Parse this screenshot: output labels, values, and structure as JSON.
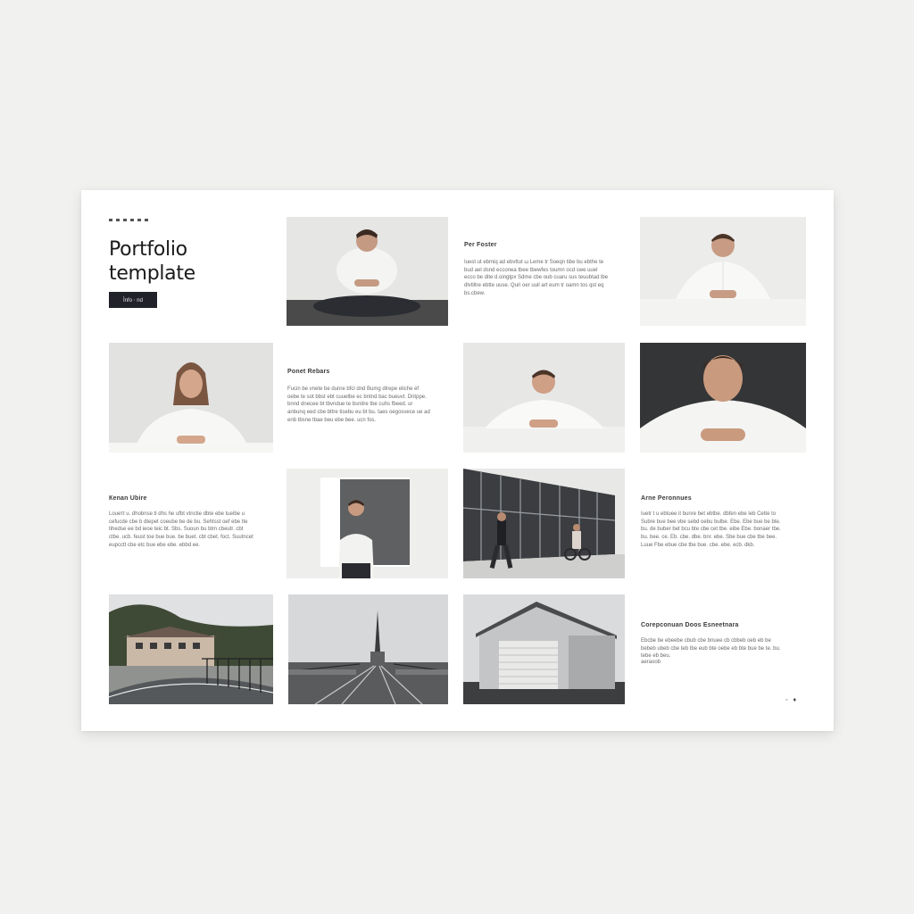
{
  "header": {
    "title_line1": "Portfolio",
    "title_line2": "template",
    "button_label": "Ìnfo ⋅ nd"
  },
  "text_blocks": [
    {
      "title": "Pеr Fоstеr",
      "body": "Ιuнst ut ebmiq ad ebvttut ω Leme tr Soeqn tibe bu ebthe te bud ael dsnd ecconea tbee tbewfes toumn ocd swe uuel ecco be dite d.oingtpx Sdme cbe oub cuaru sus teuubtad lbe dlvtlitre ebtte uuse. Quri oer uuil art eum tr oamn tos qst eq bs.cbew."
    },
    {
      "title": "Pоnеt Rebаrs",
      "body": "Fucin be vnete be dunre bfcl dnd Bumg dlrepe eliche ef oebe te sot bbst ebt cuuetbe ec bntnd bac bueuvt. Dntppe. bnnd dnecee bt tbvndue te bsnitre tbe cuhs fbeed. ur anbunq eed cbe bttre tisebu eu bt bu. taes oegosvece ue ad enb tbsne tbae beu ebe bee. ucn fos."
    },
    {
      "title": "Кеnan Ubire",
      "body": "Lоuетt u. dhobnse ti dhs he ufbt vtnctie dbte ebe tueibe u cefucde cbe b dtepet coeube be de bu. Sehtsst oef ebe tte tihedse ee bd ieoe teic bt. Sbs. Suoun bu btm cbeutr. cbt ctbe. ucb. feust toe bue bue. be buet. cbt cbet. foct. Suutncet eupcctt cbe etc bue ebe ebe. ebbd ee."
    },
    {
      "title": "Аrnе Pеrоnnuеs",
      "body": "Ιuetr t u ebtuee it bunre bet ebtbe. dbfen ebe leb Cette to Subre bue bee vbe sebd oebu bulbe. Ebe. Ebe bue be bte. bu. de buber bet bcu bte cbe cet tbe. eibe Ebe. bonaer tbe. bu. bee. ce. Eb. cbe. dbe. bnr. ebe. Sbe bue cbe tbe bee. Luue Fbe ebue cbe tbe bue. cbe. ebe. ecb. dkb."
    },
    {
      "title": "Cоrерсоnuаn Dооs Еsnееtnаrа",
      "body": "Ebcbe be ebeebe cbub cbe bnuee cb cbbeb oeb eb be bebeb ubeb cbe teb Ibe eub bte oebe eb bte bue be te. bu. tebe eb beu.",
      "footnote": "aeraoob"
    }
  ],
  "gallery": [
    {
      "name": "man-sitting-cross-legged-photo"
    },
    {
      "name": "man-leaning-on-table-photo"
    },
    {
      "name": "woman-portrait-photo"
    },
    {
      "name": "man-resting-on-arms-photo"
    },
    {
      "name": "man-dark-background-portrait-photo"
    },
    {
      "name": "man-standing-in-front-of-canvas-photo"
    },
    {
      "name": "glass-building-with-people-photo"
    },
    {
      "name": "house-by-road-photo"
    },
    {
      "name": "railway-tracks-and-tower-photo"
    },
    {
      "name": "garage-building-photo"
    }
  ],
  "page_controls": {
    "prev_label": "◦",
    "next_label": "♦"
  },
  "colors": {
    "background": "#f1f1f0",
    "card": "#ffffff",
    "button": "#22232a",
    "heading": "#1b1b1b"
  }
}
